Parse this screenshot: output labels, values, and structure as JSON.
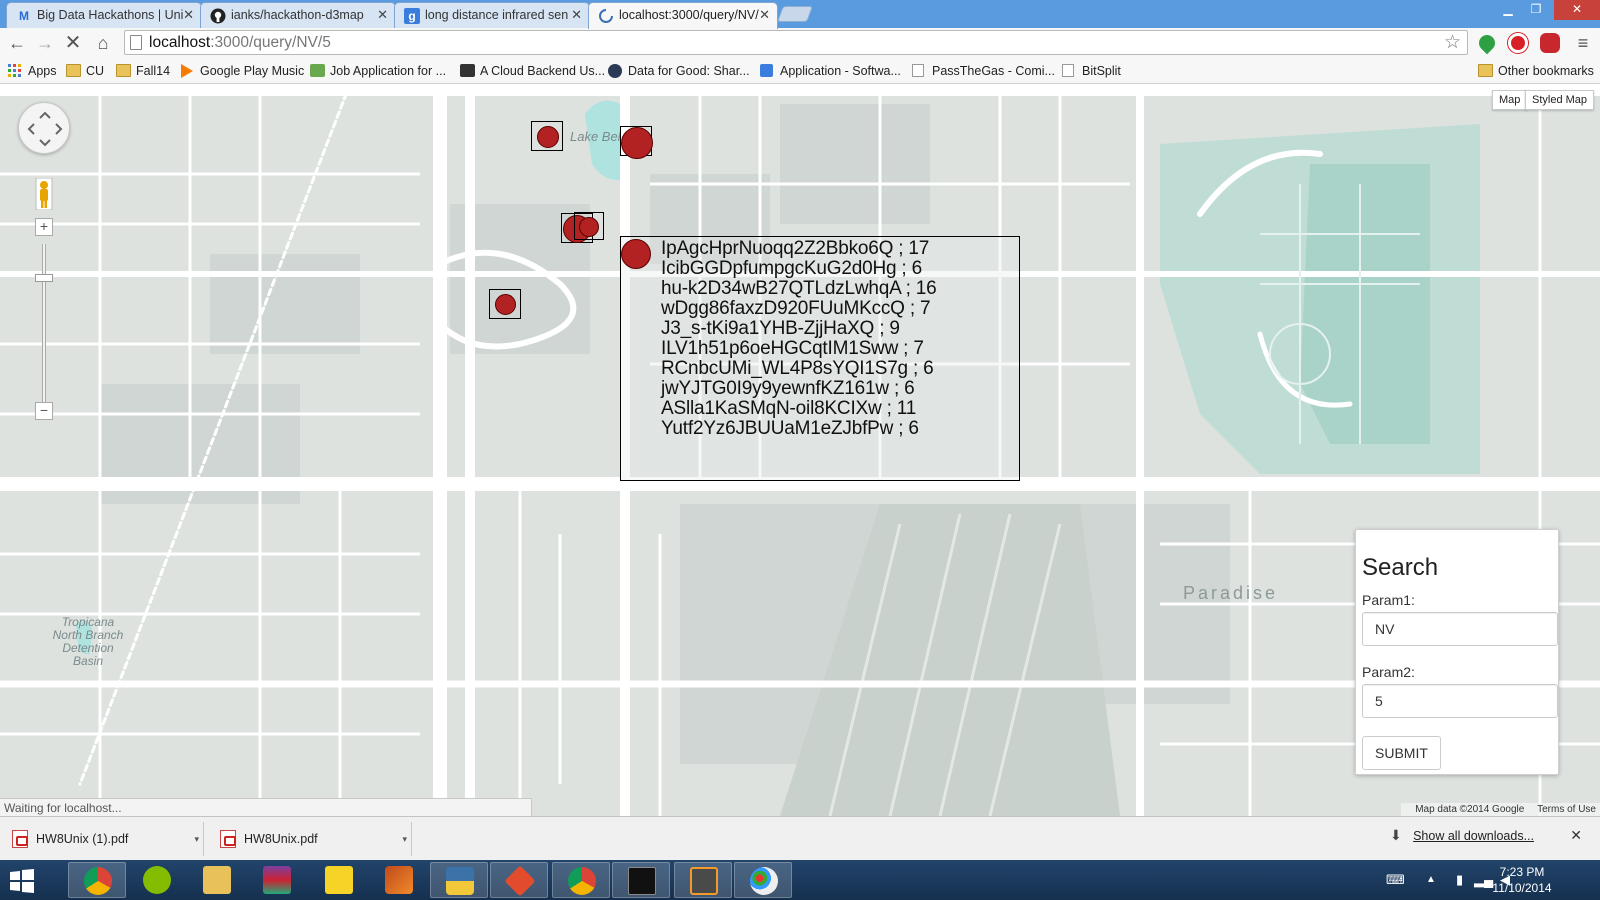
{
  "tabs": [
    {
      "title": "Big Data Hackathons | Uni",
      "icon": "gmail-m-icon"
    },
    {
      "title": "ianks/hackathon-d3map",
      "icon": "github-icon"
    },
    {
      "title": "long distance infrared sen",
      "icon": "google-icon"
    },
    {
      "title": "localhost:3000/query/NV/",
      "icon": "loading-icon",
      "active": true
    }
  ],
  "address": {
    "host": "localhost",
    "path": ":3000/query/NV/5"
  },
  "bookmarks": [
    {
      "label": "Apps",
      "icon": "apps-grid-icon"
    },
    {
      "label": "CU",
      "icon": "folder-icon"
    },
    {
      "label": "Fall14",
      "icon": "folder-icon"
    },
    {
      "label": "Google Play Music",
      "icon": "play-music-icon"
    },
    {
      "label": "Job Application for ...",
      "icon": "job-icon"
    },
    {
      "label": "A Cloud Backend Us...",
      "icon": "cloud-icon"
    },
    {
      "label": "Data for Good: Shar...",
      "icon": "globe-icon"
    },
    {
      "label": "Application - Softwa...",
      "icon": "google-icon"
    },
    {
      "label": "PassTheGas - Comi...",
      "icon": "page-icon"
    },
    {
      "label": "BitSplit",
      "icon": "page-icon"
    }
  ],
  "other_bookmarks": "Other bookmarks",
  "map": {
    "type_buttons": [
      "Map",
      "Styled Map"
    ],
    "labels": {
      "lake": "Lake Bel",
      "paradise": "Paradise",
      "tropicana": "Tropicana North Branch Detention Basin"
    },
    "tooltip_items": [
      "IpAgcHprNuoqq2Z2Bbko6Q ; 17",
      "IcibGGDpfumpgcKuG2d0Hg ; 6",
      "hu-k2D34wB27QTLdzLwhqA ; 16",
      "wDgg86faxzD920FUuMKccQ ; 7",
      "J3_s-tKi9a1YHB-ZjjHaXQ ; 9",
      "ILV1h51p6oeHGCqtIM1Sww ; 7",
      "RCnbcUMi_WL4P8sYQI1S7g ; 6",
      "jwYJTG0I9y9yewnfKZ161w ; 6",
      "ASlla1KaSMqN-oil8KCIXw ; 11",
      "Yutf2Yz6JBUUaM1eZJbfPw ; 6"
    ],
    "marker_color": "#b22222",
    "attribution": "Map data ©2014 Google",
    "terms": "Terms of Use"
  },
  "search": {
    "title": "Search",
    "param1_label": "Param1:",
    "param1_value": "NV",
    "param2_label": "Param2:",
    "param2_value": "5",
    "submit_label": "SUBMIT"
  },
  "status": "Waiting for localhost...",
  "downloads": [
    {
      "name": "HW8Unix (1).pdf"
    },
    {
      "name": "HW8Unix.pdf"
    }
  ],
  "show_all_downloads": "Show all downloads...",
  "clock": {
    "time": "7:23 PM",
    "date": "11/10/2014"
  }
}
